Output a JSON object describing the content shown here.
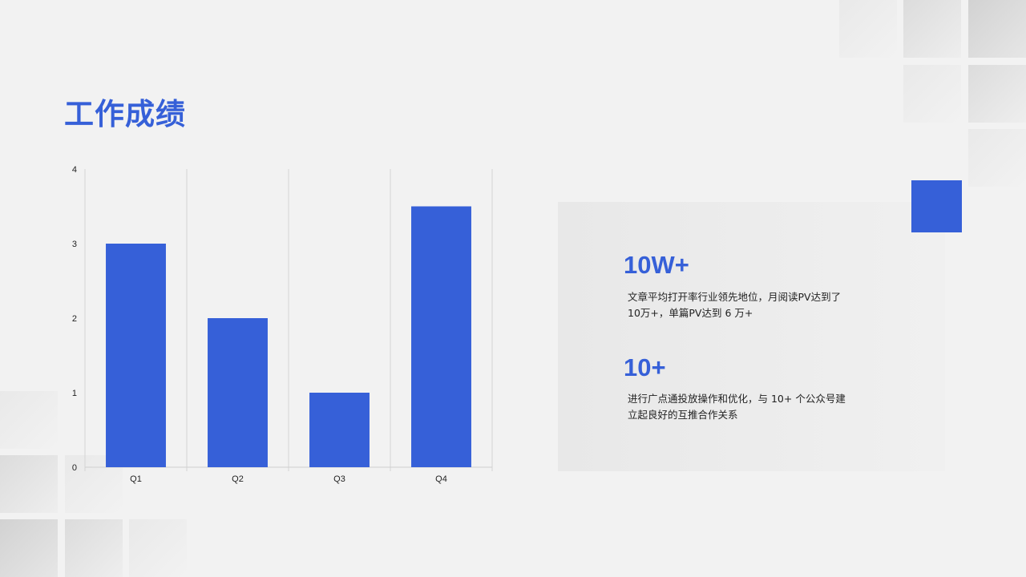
{
  "slide": {
    "title": "工作成绩"
  },
  "stats": [
    {
      "value": "10W+",
      "desc_line1": "文章平均打开率行业领先地位，月阅读PV达到了",
      "desc_line2": "10万+，单篇PV达到 6 万+"
    },
    {
      "value": "10+",
      "desc_line1": "进行广点通投放操作和优化，与 10+ 个公众号建",
      "desc_line2": "立起良好的互推合作关系"
    }
  ],
  "colors": {
    "accent": "#3660d8",
    "background": "#f2f2f2"
  },
  "chart_data": {
    "type": "bar",
    "categories": [
      "Q1",
      "Q2",
      "Q3",
      "Q4"
    ],
    "values": [
      3,
      2,
      1,
      3.5
    ],
    "ylim": [
      0,
      4
    ],
    "yticks": [
      0,
      1,
      2,
      3,
      4
    ],
    "title": "",
    "xlabel": "",
    "ylabel": "",
    "grid": true,
    "bar_color": "#3660d8"
  }
}
